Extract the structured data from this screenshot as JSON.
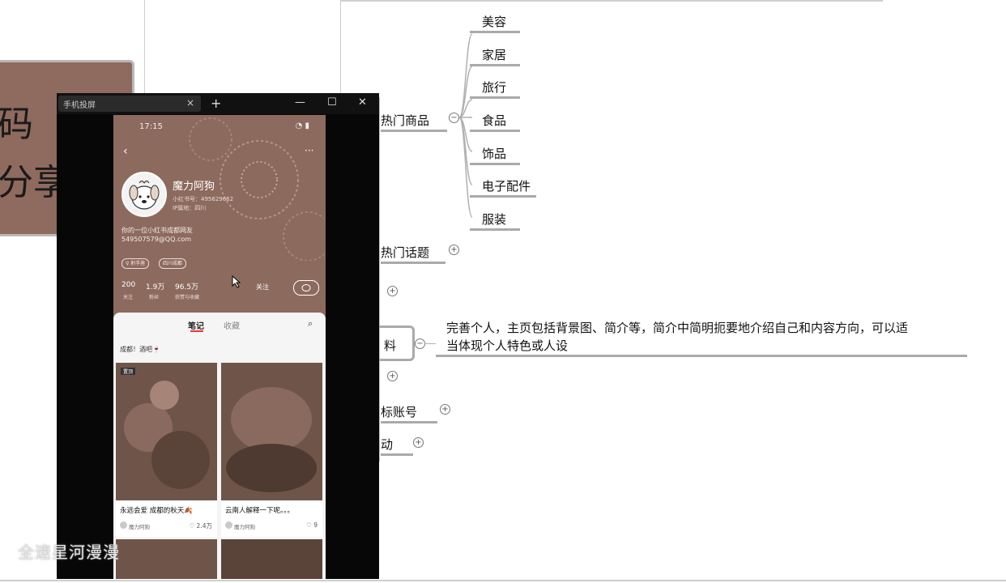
{
  "background_slide": {
    "line1": "码",
    "line2": "分享"
  },
  "mindmap": {
    "hot_products": {
      "label": "热门商品",
      "children": [
        "美容",
        "家居",
        "旅行",
        "食品",
        "饰品",
        "电子配件",
        "服装"
      ]
    },
    "hot_topics": {
      "label": "热门话题"
    },
    "profile": {
      "label_partial": "料",
      "note_line1": "完善个人，主页包括背景图、简介等，简介中简明扼要地介绍自己和内容方向，可以适",
      "note_line2": "当体现个人特色或人设"
    },
    "benchmark": {
      "label_partial": "标账号"
    },
    "interaction": {
      "label_partial": "动"
    }
  },
  "window": {
    "tab_title": "手机投屏",
    "tab_close": "×",
    "new_tab": "+",
    "minimize": "—",
    "maximize": "☐",
    "close": "✕"
  },
  "phone": {
    "time": "17:15",
    "status_icons": "◔ ▮",
    "profile": {
      "name": "魔力阿狗",
      "id_line": "小红书号：495629662",
      "ip_line": "IP属地：四川",
      "bio_line1": "你的一位小红书成都网友",
      "bio_line2": "549507579@QQ.com",
      "chips": [
        "♀ 射手座",
        "四川成都"
      ],
      "stats": [
        {
          "num": "200",
          "label": "关注"
        },
        {
          "num": "1.9万",
          "label": "粉丝"
        },
        {
          "num": "96.5万",
          "label": "获赞与收藏"
        }
      ],
      "follow_label": "关注"
    },
    "feed": {
      "tab_notes": "笔记",
      "tab_fav": "收藏",
      "pinned_tag": "成都！酒吧🍷",
      "cards": [
        {
          "title": "永远会爱 成都的秋天🍂",
          "author": "魔力阿狗",
          "likes": "♡ 2.4万",
          "badge": "置顶"
        },
        {
          "title": "云南人解释一下呢。。。",
          "author": "魔力阿狗",
          "likes": "♡ 9"
        }
      ]
    }
  },
  "watermark": "全速星河漫漫"
}
